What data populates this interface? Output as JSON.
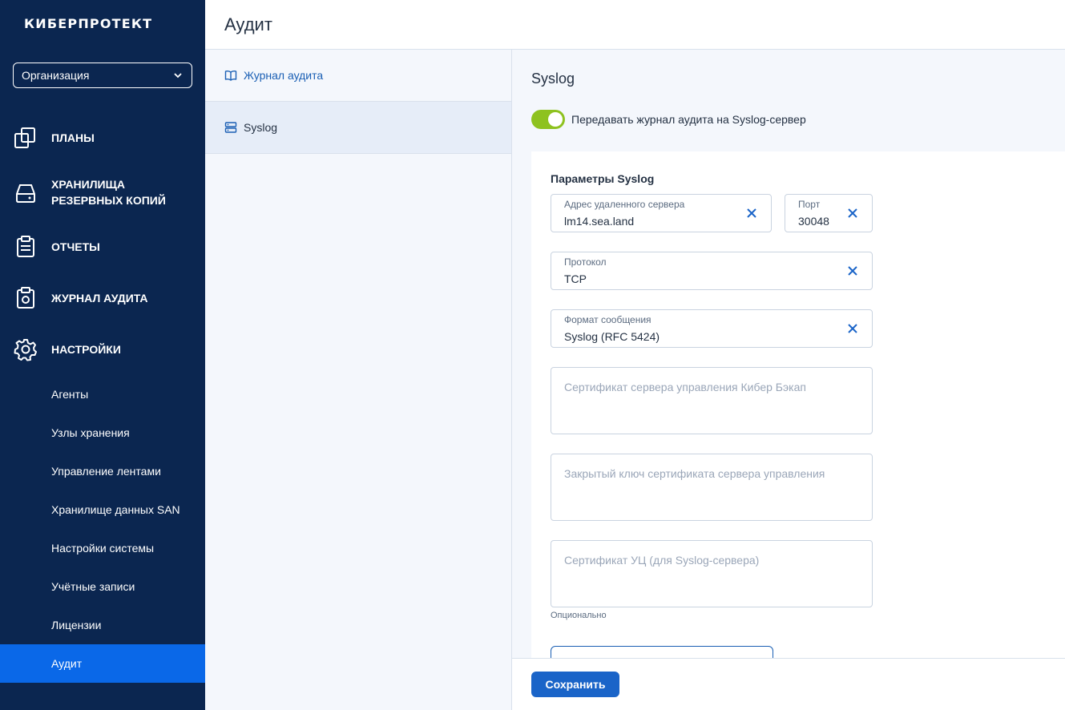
{
  "brand": {
    "logo_text": "КИБЕРПРОТЕКТ"
  },
  "org_select": {
    "value": "Организация"
  },
  "sidebar": {
    "main_items": [
      {
        "label": "ПЛАНЫ",
        "icon": "plans-icon"
      },
      {
        "label": "ХРАНИЛИЩА РЕЗЕРВНЫХ КОПИЙ",
        "icon": "storage-icon"
      },
      {
        "label": "ОТЧЕТЫ",
        "icon": "reports-icon"
      },
      {
        "label": "ЖУРНАЛ АУДИТА",
        "icon": "audit-log-icon"
      },
      {
        "label": "НАСТРОЙКИ",
        "icon": "gear-icon"
      }
    ],
    "sub_items": [
      {
        "label": "Агенты"
      },
      {
        "label": "Узлы хранения"
      },
      {
        "label": "Управление лентами"
      },
      {
        "label": "Хранилище данных SAN"
      },
      {
        "label": "Настройки системы"
      },
      {
        "label": "Учётные записи"
      },
      {
        "label": "Лицензии"
      },
      {
        "label": "Аудит",
        "active": true
      }
    ]
  },
  "header": {
    "title": "Аудит"
  },
  "subpanel": {
    "items": [
      {
        "label": "Журнал аудита",
        "icon": "book-icon"
      },
      {
        "label": "Syslog",
        "icon": "server-icon",
        "selected": true
      }
    ]
  },
  "main": {
    "title": "Syslog",
    "toggle": {
      "label": "Передавать журнал аудита на Syslog-сервер",
      "on": true
    },
    "section_title": "Параметры Syslog",
    "fields": {
      "server": {
        "label": "Адрес удаленного сервера",
        "value": "lm14.sea.land"
      },
      "port": {
        "label": "Порт",
        "value": "30048"
      },
      "protocol": {
        "label": "Протокол",
        "value": "TCP"
      },
      "format": {
        "label": "Формат сообщения",
        "value": "Syslog (RFC 5424)"
      },
      "server_cert": {
        "placeholder": "Сертификат сервера управления Кибер Бэкап"
      },
      "private_key": {
        "placeholder": "Закрытый ключ сертификата сервера управления"
      },
      "ca_cert": {
        "placeholder": "Сертификат УЦ (для Syslog-сервера)"
      }
    },
    "optional_hint": "Опционально"
  },
  "footer": {
    "save_label": "Сохранить"
  },
  "colors": {
    "sidebar_bg": "#0b2650",
    "active_item": "#0a68e8",
    "toggle_on": "#8ec21f",
    "primary_button": "#1a64c8",
    "link": "#1a5fb4"
  }
}
